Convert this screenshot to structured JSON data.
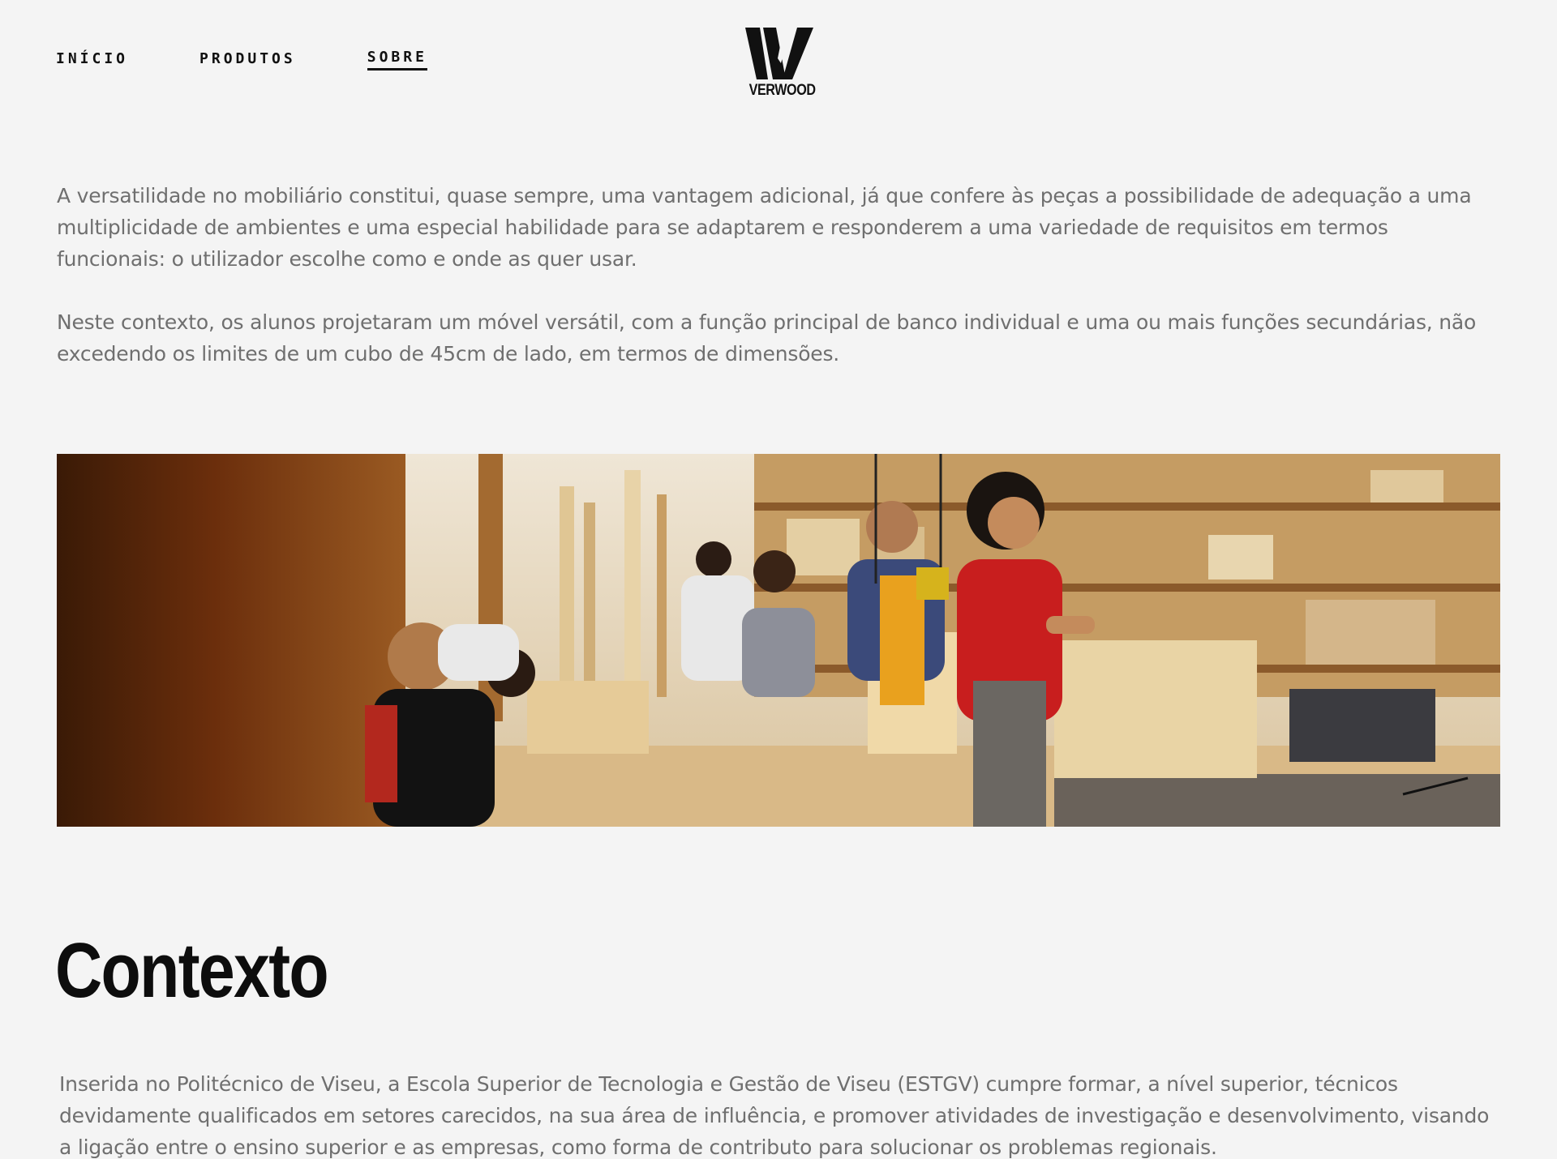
{
  "header": {
    "nav": [
      {
        "label": "INÍCIO",
        "active": false
      },
      {
        "label": "PRODUTOS",
        "active": false
      },
      {
        "label": "SOBRE",
        "active": true
      }
    ],
    "logo_text": "VERWOOD"
  },
  "intro": {
    "paragraph_1": "A versatilidade no mobiliário constitui, quase sempre, uma vantagem adicional, já que confere às peças a possibilidade de adequação a uma multiplicidade de ambientes e uma especial habilidade para se adaptarem e responderem a uma variedade de requisitos em termos funcionais: o utilizador escolhe como e onde as quer usar.",
    "paragraph_2": "Neste contexto, os alunos projetaram um móvel versátil, com a função principal de banco individual e uma ou mais funções secundárias, não excedendo os limites de um cubo de 45cm de lado, em termos de dimensões."
  },
  "context": {
    "title": "Contexto",
    "text": "Inserida no Politécnico de Viseu, a Escola Superior de Tecnologia e Gestão de Viseu (ESTGV) cumpre formar, a nível superior, técnicos devidamente qualificados em setores carecidos, na sua área de influência, e promover atividades de investigação e desenvolvimento, visando a ligação entre o ensino superior e as empresas, como forma de contributo para solucionar os problemas regionais."
  },
  "colors": {
    "background": "#f4f4f4",
    "text": "#6f6f6f",
    "heading": "#0d0d0d"
  }
}
